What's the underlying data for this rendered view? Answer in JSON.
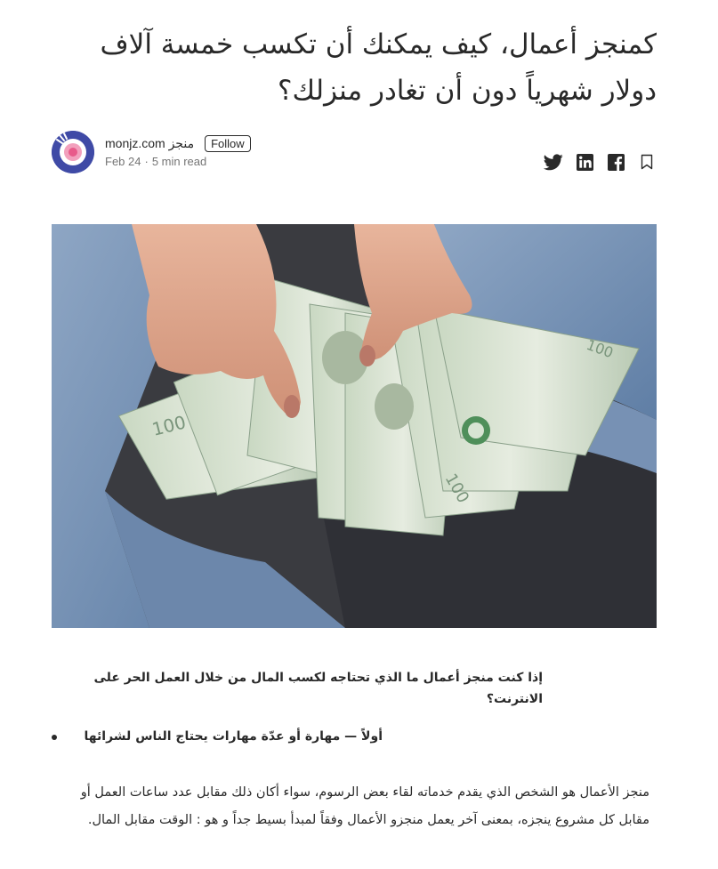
{
  "article": {
    "title": "كمنجز أعمال، كيف يمكنك أن تكسب خمسة آلاف دولار شهرياً دون أن تغادر منزلك؟",
    "author": {
      "name": "monjz.com منجز",
      "follow_label": "Follow",
      "date": "Feb 24",
      "separator": "·",
      "read_time": "5 min read"
    },
    "share": {
      "icons": [
        "twitter-icon",
        "linkedin-icon",
        "facebook-icon",
        "bookmark-icon"
      ]
    },
    "hero_image": {
      "subject": "hands fanning out 100 dollar bills"
    },
    "question_heading": "إذا كنت منجز أعمال ما الذي تحتاجه لكسب المال من خلال العمل الحر على الانترنت؟",
    "bullets": [
      "أولاً — مهارة أو عدّة مهارات يحتاج الناس لشرائها"
    ],
    "paragraph": "منجز الأعمال هو الشخص الذي يقدم خدماته لقاء بعض الرسوم، سواء أكان ذلك مقابل عدد ساعات العمل أو مقابل كل مشروع ينجزه، بمعنى آخر يعمل منجزو الأعمال وفقاً لمبدأ بسيط جداً و هو : الوقت مقابل المال."
  },
  "colors": {
    "text": "#292929",
    "muted": "#757575",
    "avatar_bg": "#3f4aa6",
    "avatar_accent": "#e85a8a"
  }
}
